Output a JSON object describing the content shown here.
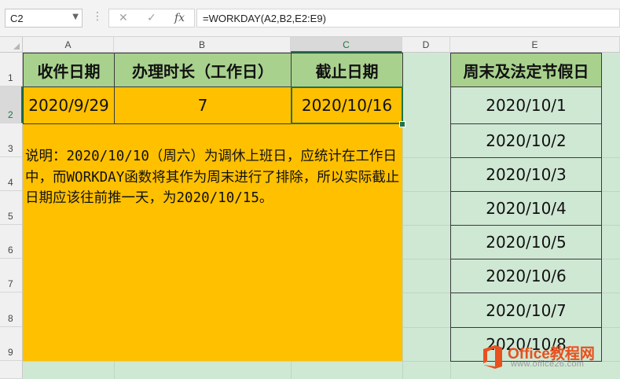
{
  "formula_bar": {
    "name_box": "C2",
    "formula": "=WORKDAY(A2,B2,E2:E9)",
    "cancel_icon": "✕",
    "enter_icon": "✓",
    "fx_icon": "fx"
  },
  "columns": [
    "A",
    "B",
    "C",
    "D",
    "E"
  ],
  "rows": [
    "1",
    "2",
    "3",
    "4",
    "5",
    "6",
    "7",
    "8",
    "9"
  ],
  "selected_cell": "C2",
  "headers": {
    "a1": "收件日期",
    "b1": "办理时长（工作日）",
    "c1": "截止日期",
    "e1": "周末及法定节假日"
  },
  "values": {
    "a2": "2020/9/29",
    "b2": "7",
    "c2": "2020/10/16"
  },
  "holidays": [
    "2020/10/1",
    "2020/10/2",
    "2020/10/3",
    "2020/10/4",
    "2020/10/5",
    "2020/10/6",
    "2020/10/7",
    "2020/10/8"
  ],
  "note": "说明：2020/10/10（周六）为调休上班日，应统计在工作日中，而WORKDAY函数将其作为周末进行了排除，所以实际截止日期应该往前推一天，为2020/10/15。",
  "watermark": {
    "brand": "Office教程网",
    "url": "www.office26.com"
  },
  "colors": {
    "header_fill": "#a9d18e",
    "value_fill": "#ffc000",
    "sheet_bg": "#cfe8d4",
    "selection": "#217346"
  }
}
